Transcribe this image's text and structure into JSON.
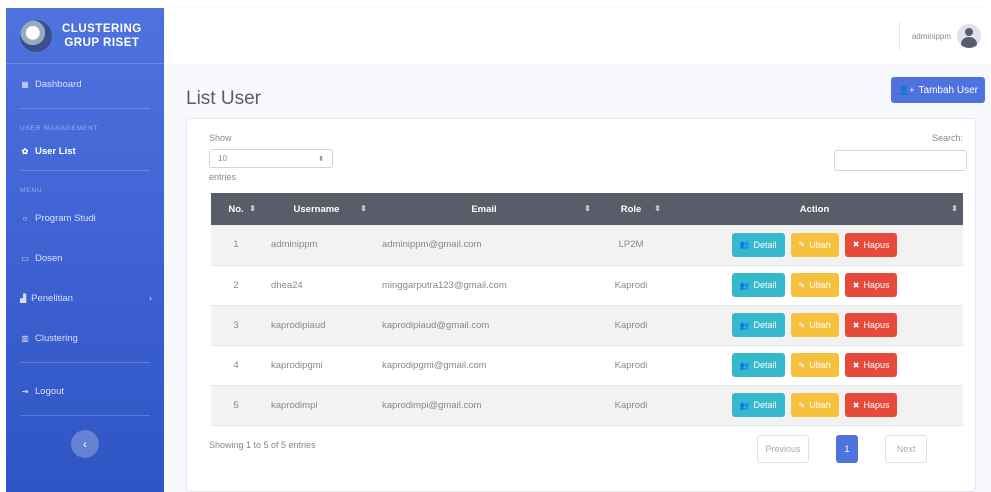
{
  "sidebar": {
    "brand_line1": "CLUSTERING",
    "brand_line2": "GRUP RISET",
    "dashboard": "Dashboard",
    "section_user": "USER MANAGEMENT",
    "user_list": "User List",
    "section_menu": "MENU",
    "program_studi": "Program Studi",
    "dosen": "Dosen",
    "penelitian": "Penelitian",
    "clustering": "Clustering",
    "logout": "Logout"
  },
  "topbar": {
    "username": "adminippm"
  },
  "page": {
    "title": "List User",
    "add_button": "Tambah User"
  },
  "controls": {
    "show_label": "Show",
    "length_value": "10",
    "entries_label": "entries",
    "search_label": "Search:"
  },
  "table": {
    "headers": {
      "no": "No.",
      "username": "Username",
      "email": "Email",
      "role": "Role",
      "action": "Action"
    },
    "buttons": {
      "detail": "Detail",
      "ubah": "Ubah",
      "hapus": "Hapus"
    },
    "rows": [
      {
        "no": "1",
        "username": "adminippm",
        "email": "adminippm@gmail.com",
        "role": "LP2M"
      },
      {
        "no": "2",
        "username": "dhea24",
        "email": "minggarputra123@gmail.com",
        "role": "Kaprodi"
      },
      {
        "no": "3",
        "username": "kaprodipiaud",
        "email": "kaprodipiaud@gmail.com",
        "role": "Kaprodi"
      },
      {
        "no": "4",
        "username": "kaprodipgmi",
        "email": "kaprodipgmi@gmail.com",
        "role": "Kaprodi"
      },
      {
        "no": "5",
        "username": "kaprodimpi",
        "email": "kaprodimpi@gmail.com",
        "role": "Kaprodi"
      }
    ]
  },
  "footer": {
    "info": "Showing 1 to 5 of 5 entries",
    "previous": "Previous",
    "page": "1",
    "next": "Next"
  },
  "colors": {
    "primary": "#4e73df",
    "info": "#36b9cc",
    "warning": "#f6c23e",
    "danger": "#e74a3b",
    "header": "#5a5c69"
  }
}
